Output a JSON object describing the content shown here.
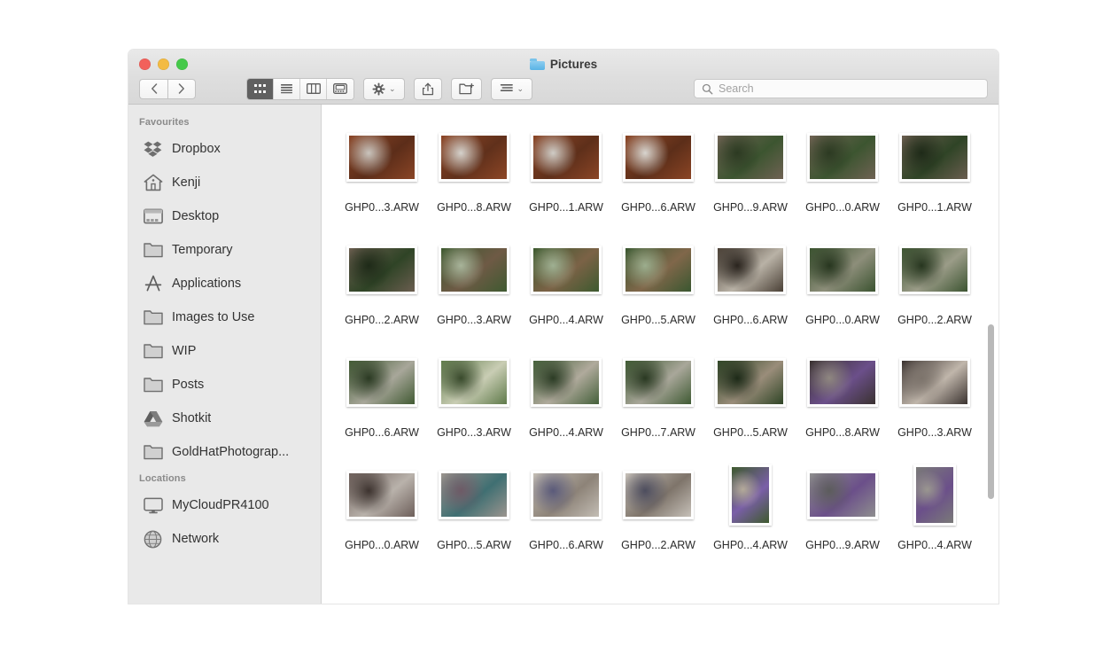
{
  "window": {
    "title": "Pictures",
    "title_icon": "blue-folder-icon",
    "traffic_lights": [
      "close-button",
      "minimize-button",
      "zoom-button"
    ]
  },
  "toolbar": {
    "back_label": "‹",
    "forward_label": "›",
    "view_modes": [
      {
        "name": "icon-view",
        "icon": "grid-icon",
        "active": true
      },
      {
        "name": "list-view",
        "icon": "list-icon",
        "active": false
      },
      {
        "name": "column-view",
        "icon": "columns-icon",
        "active": false
      },
      {
        "name": "gallery-view",
        "icon": "coverflow-icon",
        "active": false
      }
    ],
    "action_button": "gear-icon",
    "share_button": "share-icon",
    "new_folder_button": "new-folder-icon",
    "arrange_button": "arrange-icon",
    "chevron": "⌄"
  },
  "search": {
    "placeholder": "Search",
    "value": "",
    "icon": "search-icon"
  },
  "sidebar": {
    "sections": [
      {
        "header": "Favourites",
        "items": [
          {
            "label": "Dropbox",
            "icon": "dropbox-icon"
          },
          {
            "label": "Kenji",
            "icon": "home-icon"
          },
          {
            "label": "Desktop",
            "icon": "desktop-icon"
          },
          {
            "label": "Temporary",
            "icon": "folder-icon"
          },
          {
            "label": "Applications",
            "icon": "applications-icon"
          },
          {
            "label": "Images to Use",
            "icon": "folder-icon"
          },
          {
            "label": "WIP",
            "icon": "folder-icon"
          },
          {
            "label": "Posts",
            "icon": "folder-icon"
          },
          {
            "label": "Shotkit",
            "icon": "google-drive-icon"
          },
          {
            "label": "GoldHatPhotograp...",
            "icon": "folder-icon"
          }
        ]
      },
      {
        "header": "Locations",
        "items": [
          {
            "label": "MyCloudPR4100",
            "icon": "display-icon"
          },
          {
            "label": "Network",
            "icon": "globe-icon"
          }
        ]
      }
    ]
  },
  "files": [
    {
      "name": "GHP0...3.ARW",
      "orientation": "landscape",
      "scene": "camera-on-wood",
      "c1": "#7a3b22",
      "c2": "#a8apc",
      "colors": [
        "#8a4526",
        "#5c2d19",
        "#c9c4bd"
      ]
    },
    {
      "name": "GHP0...8.ARW",
      "orientation": "landscape",
      "scene": "camera-on-wood",
      "colors": [
        "#8d4626",
        "#60301b",
        "#d5d2cc"
      ]
    },
    {
      "name": "GHP0...1.ARW",
      "orientation": "landscape",
      "scene": "camera-on-wood",
      "colors": [
        "#8b4526",
        "#5e2f1a",
        "#cfccc6"
      ]
    },
    {
      "name": "GHP0...6.ARW",
      "orientation": "landscape",
      "scene": "camera-on-wood",
      "colors": [
        "#8b4525",
        "#5c2e19",
        "#d8d5cf"
      ]
    },
    {
      "name": "GHP0...9.ARW",
      "orientation": "landscape",
      "scene": "fence-garden",
      "colors": [
        "#6f6253",
        "#3c5530",
        "#2c3a22"
      ]
    },
    {
      "name": "GHP0...0.ARW",
      "orientation": "landscape",
      "scene": "fence-garden",
      "colors": [
        "#6f6253",
        "#3c5530",
        "#2c3a22"
      ]
    },
    {
      "name": "GHP0...1.ARW",
      "orientation": "landscape",
      "scene": "fence-tap",
      "colors": [
        "#6a5d4f",
        "#2f4426",
        "#1e2a18"
      ]
    },
    {
      "name": "GHP0...2.ARW",
      "orientation": "landscape",
      "scene": "fence-tap",
      "colors": [
        "#6a5d4f",
        "#2f4426",
        "#1e2a18"
      ]
    },
    {
      "name": "GHP0...3.ARW",
      "orientation": "landscape",
      "scene": "garden-hose",
      "colors": [
        "#3f5a31",
        "#6e5a45",
        "#a8b49a"
      ]
    },
    {
      "name": "GHP0...4.ARW",
      "orientation": "landscape",
      "scene": "garden-hose",
      "colors": [
        "#3d5a2f",
        "#7b6246",
        "#9fb092"
      ]
    },
    {
      "name": "GHP0...5.ARW",
      "orientation": "landscape",
      "scene": "garden-hose",
      "colors": [
        "#3a5730",
        "#80674a",
        "#9cad8d"
      ]
    },
    {
      "name": "GHP0...6.ARW",
      "orientation": "landscape",
      "scene": "child-indoor",
      "colors": [
        "#4a4036",
        "#b9b2a6",
        "#2a241e"
      ]
    },
    {
      "name": "GHP0...0.ARW",
      "orientation": "landscape",
      "scene": "child-garden",
      "colors": [
        "#3b5330",
        "#8d8e7a",
        "#27361f"
      ]
    },
    {
      "name": "GHP0...2.ARW",
      "orientation": "landscape",
      "scene": "child-garden",
      "colors": [
        "#3c5431",
        "#9b9c88",
        "#27361f"
      ]
    },
    {
      "name": "GHP0...6.ARW",
      "orientation": "landscape",
      "scene": "child-path",
      "colors": [
        "#415a33",
        "#a8a79a",
        "#2b3a23"
      ]
    },
    {
      "name": "GHP0...3.ARW",
      "orientation": "landscape",
      "scene": "child-tree",
      "colors": [
        "#5f7a4a",
        "#c9cdb4",
        "#394a2c"
      ]
    },
    {
      "name": "GHP0...4.ARW",
      "orientation": "landscape",
      "scene": "child-path",
      "colors": [
        "#44603a",
        "#b0aa9c",
        "#2c3c25"
      ]
    },
    {
      "name": "GHP0...7.ARW",
      "orientation": "landscape",
      "scene": "children-path",
      "colors": [
        "#3f5a33",
        "#a9a79a",
        "#2a3922"
      ]
    },
    {
      "name": "GHP0...5.ARW",
      "orientation": "landscape",
      "scene": "children-garden",
      "colors": [
        "#2f4526",
        "#9a8d7a",
        "#1d2a18"
      ]
    },
    {
      "name": "GHP0...8.ARW",
      "orientation": "landscape",
      "scene": "child-indoor",
      "colors": [
        "#3a3230",
        "#6b4f8a",
        "#8f8780"
      ]
    },
    {
      "name": "GHP0...3.ARW",
      "orientation": "landscape",
      "scene": "child-indoor",
      "colors": [
        "#3b3330",
        "#c0b6ab",
        "#7d746c"
      ]
    },
    {
      "name": "GHP0...0.ARW",
      "orientation": "landscape",
      "scene": "family-indoor",
      "colors": [
        "#6d5f5a",
        "#b9b2ab",
        "#3d332f"
      ]
    },
    {
      "name": "GHP0...5.ARW",
      "orientation": "landscape",
      "scene": "family-indoor",
      "colors": [
        "#9b948e",
        "#3f6f72",
        "#6e5a66"
      ]
    },
    {
      "name": "GHP0...6.ARW",
      "orientation": "landscape",
      "scene": "child-wall",
      "colors": [
        "#c3bdb4",
        "#8d8378",
        "#5a5a7a"
      ]
    },
    {
      "name": "GHP0...2.ARW",
      "orientation": "landscape",
      "scene": "family-wall",
      "colors": [
        "#c6c0b8",
        "#7e746a",
        "#4d4d5e"
      ]
    },
    {
      "name": "GHP0...4.ARW",
      "orientation": "portrait",
      "scene": "child-purple",
      "colors": [
        "#3e5a2e",
        "#7a5fa8",
        "#b4aa9a"
      ]
    },
    {
      "name": "GHP0...9.ARW",
      "orientation": "landscape",
      "scene": "child-grey-wall",
      "colors": [
        "#8e8e8e",
        "#6b4f8a",
        "#5c5c5c"
      ]
    },
    {
      "name": "GHP0...4.ARW",
      "orientation": "portrait",
      "scene": "child-purple",
      "colors": [
        "#7a7a78",
        "#6b4f8a",
        "#9a9690"
      ]
    }
  ],
  "scrollbar": {
    "thumb_top_pct": 44,
    "thumb_height_pct": 35
  },
  "colors": {
    "sidebar_bg": "#e9e9e9",
    "titlebar_bg": "#dedede",
    "content_bg": "#ffffff",
    "text": "#2b2b2b",
    "muted_text": "#8a8a8a"
  }
}
